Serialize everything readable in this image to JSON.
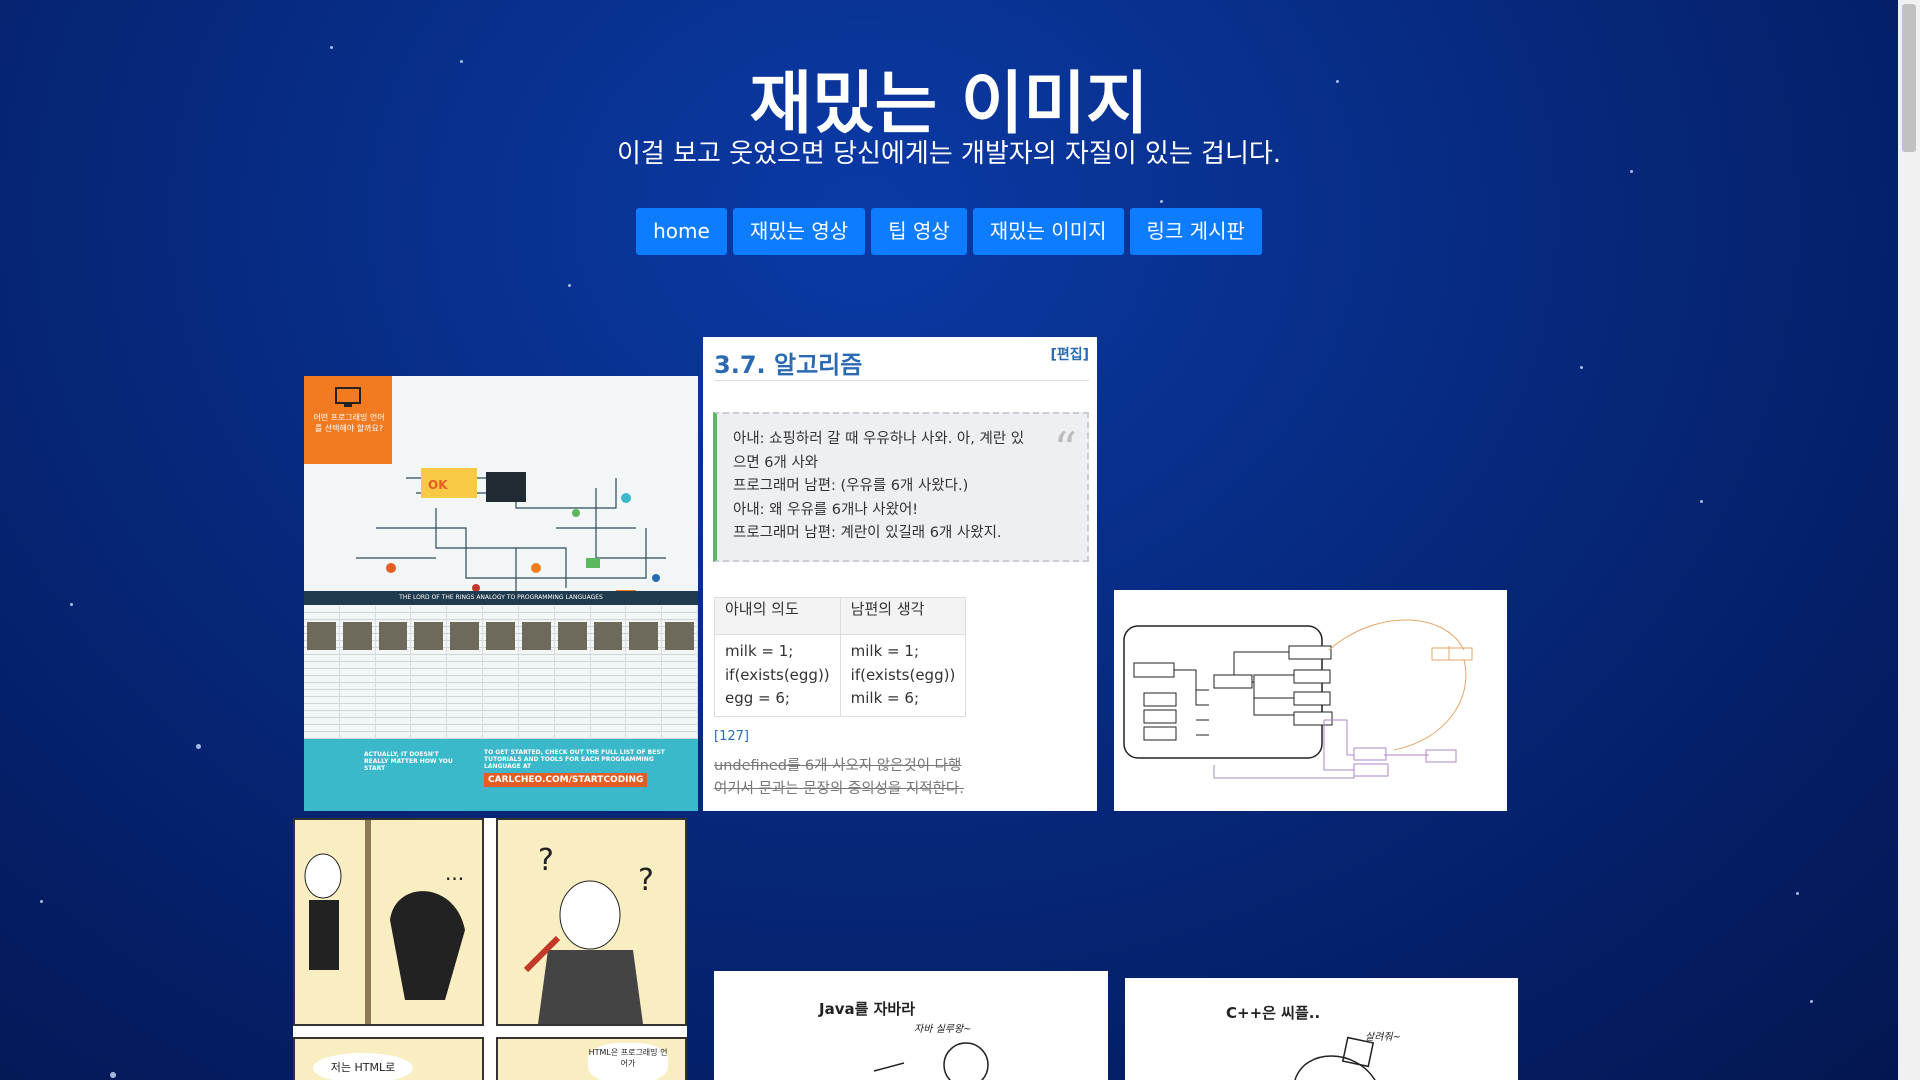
{
  "header": {
    "title": "재밌는 이미지",
    "subtitle": "이걸 보고 웃었으면 당신에게는 개발자의 자질이 있는 겁니다."
  },
  "nav": [
    {
      "label": "home"
    },
    {
      "label": "재밌는 영상"
    },
    {
      "label": "팁 영상"
    },
    {
      "label": "재밌는 이미지"
    },
    {
      "label": "링크 게시판"
    }
  ],
  "images": {
    "infographic": {
      "heading": "어떤 프로그래밍 언어를 선택해야 할까요?",
      "banner": "THE LORD OF THE RINGS ANALOGY TO PROGRAMMING LANGUAGES",
      "footer_left": "ACTUALLY, IT DOESN'T REALLY MATTER HOW YOU START",
      "footer_right": "TO GET STARTED, CHECK OUT THE FULL LIST OF BEST TUTORIALS AND TOOLS FOR EACH PROGRAMMING LANGUAGE AT",
      "footer_url": "CARLCHEO.COM/STARTCODING"
    },
    "algorithm": {
      "heading": "3.7. 알고리즘",
      "edit_label": "[편집]",
      "quote_lines": [
        "아내: 쇼핑하러 갈 때 우유하나 사와. 아, 계란 있으면 6개 사와",
        "프로그래머 남편: (우유를 6개 사왔다.)",
        "아내: 왜 우유를 6개나 사왔어!",
        "프로그래머 남편: 계란이 있길래 6개 사왔지."
      ],
      "table": {
        "headers": [
          "아내의 의도",
          "남편의 생각"
        ],
        "wife": [
          "milk = 1;",
          "if(exists(egg))",
          "egg = 6;"
        ],
        "husband": [
          "milk = 1;",
          "if(exists(egg))",
          "milk = 6;"
        ]
      },
      "ref": "[127]",
      "strike_lines": [
        "undefined를 6개 사오지 않은것이 다행",
        "여기서 문과는 문장의 중의성을 지적한다."
      ]
    },
    "java": {
      "caption": "Java를 자바라",
      "sub": "자바 실루왕~"
    },
    "cpp": {
      "caption": "C++은 씨플..",
      "sub": "살려줘~"
    },
    "comic": {
      "bubble1": "저는 HTML로",
      "bubble2": "HTML은 프로그래밍 언어가"
    }
  },
  "colors": {
    "nav_button": "#0d7cff",
    "background": "#072d86"
  }
}
